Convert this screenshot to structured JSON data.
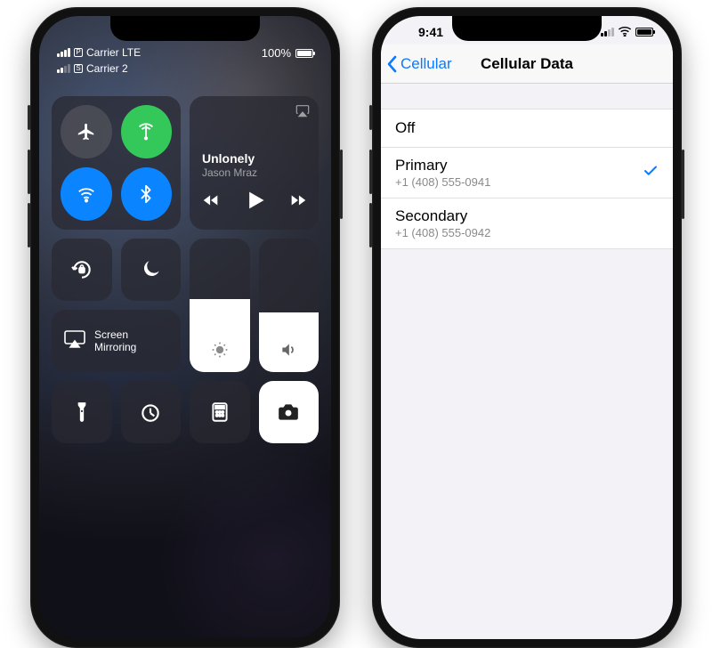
{
  "left": {
    "carriers": [
      {
        "sim_badge": "P",
        "name": "Carrier LTE",
        "strength": 4
      },
      {
        "sim_badge": "S",
        "name": "Carrier 2",
        "strength": 2
      }
    ],
    "battery_label": "100%",
    "music": {
      "title": "Unlonely",
      "artist": "Jason Mraz"
    },
    "screen_mirroring_label": "Screen\nMirroring",
    "icons": {
      "airplane": "airplane-icon",
      "celldata": "antenna-icon",
      "wifi": "wifi-icon",
      "bluetooth": "bluetooth-icon",
      "airplay": "airplay-icon",
      "rewind": "skip-back-icon",
      "play": "play-icon",
      "forward": "skip-forward-icon",
      "lock": "orientation-lock-icon",
      "dnd": "moon-icon",
      "mirror": "screen-mirroring-icon",
      "brightness": "sun-icon",
      "volume": "speaker-icon",
      "flashlight": "flashlight-icon",
      "timer": "timer-icon",
      "calculator": "calculator-icon",
      "camera": "camera-icon"
    }
  },
  "right": {
    "time": "9:41",
    "nav": {
      "back": "Cellular",
      "title": "Cellular Data"
    },
    "rows": {
      "off": {
        "label": "Off",
        "selected": false
      },
      "primary": {
        "label": "Primary",
        "detail": "+1 (408) 555-0941",
        "selected": true
      },
      "secondary": {
        "label": "Secondary",
        "detail": "+1 (408) 555-0942",
        "selected": false
      }
    }
  }
}
